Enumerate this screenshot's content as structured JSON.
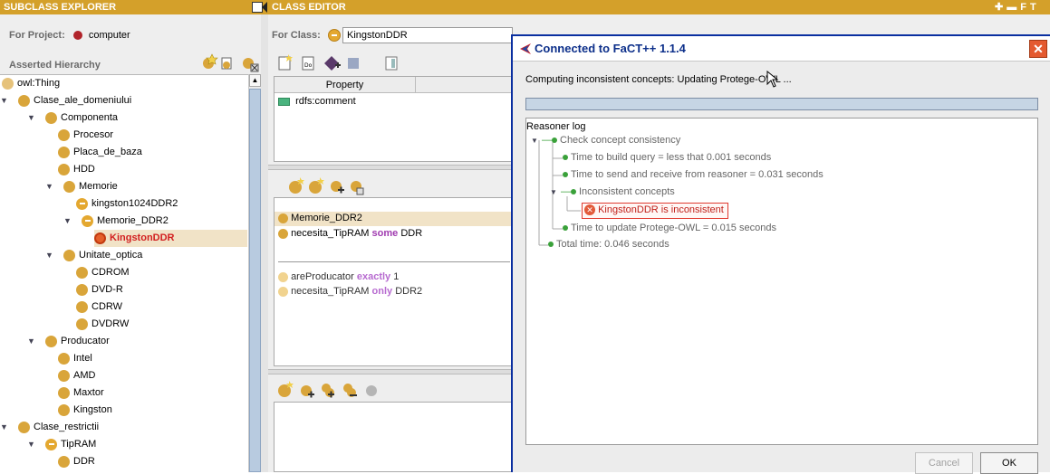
{
  "subclass_explorer": {
    "title": "SUBCLASS EXPLORER",
    "project_label": "For Project:",
    "project_name": "computer",
    "hierarchy_label": "Asserted Hierarchy",
    "tree": [
      {
        "label": "owl:Thing",
        "depth": 0,
        "toggle": "",
        "icon": "class-icon"
      },
      {
        "label": "Clase_ale_domeniului",
        "depth": 0,
        "toggle": "▼",
        "icon": "class-icon"
      },
      {
        "label": "Componenta",
        "depth": 1,
        "toggle": "▼",
        "icon": "class-icon"
      },
      {
        "label": "Procesor",
        "depth": 2,
        "toggle": "",
        "icon": "class-icon"
      },
      {
        "label": "Placa_de_baza",
        "depth": 2,
        "toggle": "",
        "icon": "class-icon"
      },
      {
        "label": "HDD",
        "depth": 2,
        "toggle": "",
        "icon": "class-icon"
      },
      {
        "label": "Memorie",
        "depth": 2,
        "toggle": "▼",
        "icon": "class-icon"
      },
      {
        "label": "kingston1024DDR2",
        "depth": 3,
        "toggle": "",
        "icon": "defined-class-icon"
      },
      {
        "label": "Memorie_DDR2",
        "depth": 3,
        "toggle": "▼",
        "icon": "defined-class-icon"
      },
      {
        "label": "KingstonDDR",
        "depth": 4,
        "toggle": "",
        "icon": "inconsistent-class-icon"
      },
      {
        "label": "Unitate_optica",
        "depth": 2,
        "toggle": "▼",
        "icon": "class-icon"
      },
      {
        "label": "CDROM",
        "depth": 3,
        "toggle": "",
        "icon": "class-icon"
      },
      {
        "label": "DVD-R",
        "depth": 3,
        "toggle": "",
        "icon": "class-icon"
      },
      {
        "label": "CDRW",
        "depth": 3,
        "toggle": "",
        "icon": "class-icon"
      },
      {
        "label": "DVDRW",
        "depth": 3,
        "toggle": "",
        "icon": "class-icon"
      },
      {
        "label": "Producator",
        "depth": 1,
        "toggle": "▼",
        "icon": "class-icon"
      },
      {
        "label": "Intel",
        "depth": 2,
        "toggle": "",
        "icon": "class-icon"
      },
      {
        "label": "AMD",
        "depth": 2,
        "toggle": "",
        "icon": "class-icon"
      },
      {
        "label": "Maxtor",
        "depth": 2,
        "toggle": "",
        "icon": "class-icon"
      },
      {
        "label": "Kingston",
        "depth": 2,
        "toggle": "",
        "icon": "class-icon"
      },
      {
        "label": "Clase_restrictii",
        "depth": 0,
        "toggle": "▼",
        "icon": "class-icon"
      },
      {
        "label": "TipRAM",
        "depth": 1,
        "toggle": "▼",
        "icon": "defined-class-icon"
      },
      {
        "label": "DDR",
        "depth": 2,
        "toggle": "",
        "icon": "class-icon"
      }
    ]
  },
  "class_editor": {
    "title": "CLASS EDITOR",
    "class_label": "For Class:",
    "class_name": "KingstonDDR",
    "property_header": "Property",
    "property_row": "rdfs:comment",
    "superclasses": [
      {
        "name": "Memorie_DDR2",
        "keyword": "",
        "rest": ""
      },
      {
        "name": "necesita_TipRAM",
        "keyword": "some",
        "rest": "DDR"
      }
    ],
    "restrictions": [
      {
        "name": "areProducator",
        "keyword": "exactly",
        "rest": "1"
      },
      {
        "name": "necesita_TipRAM",
        "keyword": "only",
        "rest": "DDR2"
      }
    ]
  },
  "dialog": {
    "title": "Connected to FaCT++ 1.1.4",
    "status": "Computing inconsistent concepts: Updating Protege-OWL ...",
    "log_label": "Reasoner log",
    "log": {
      "check": "Check concept consistency",
      "build": "Time to build query = less that 0.001 seconds",
      "send": "Time to send and receive from reasoner = 0.031 seconds",
      "inconsistent": "Inconsistent concepts",
      "error": "KingstonDDR is inconsistent",
      "update": "Time to update Protege-OWL = 0.015 seconds",
      "total": "Total time: 0.046 seconds"
    },
    "cancel_label": "Cancel",
    "ok_label": "OK",
    "colors": {
      "title_bar": "#ffffff",
      "close": "#e45a30",
      "error_border": "#e03a30",
      "log_dot": "#3aa13a"
    }
  }
}
